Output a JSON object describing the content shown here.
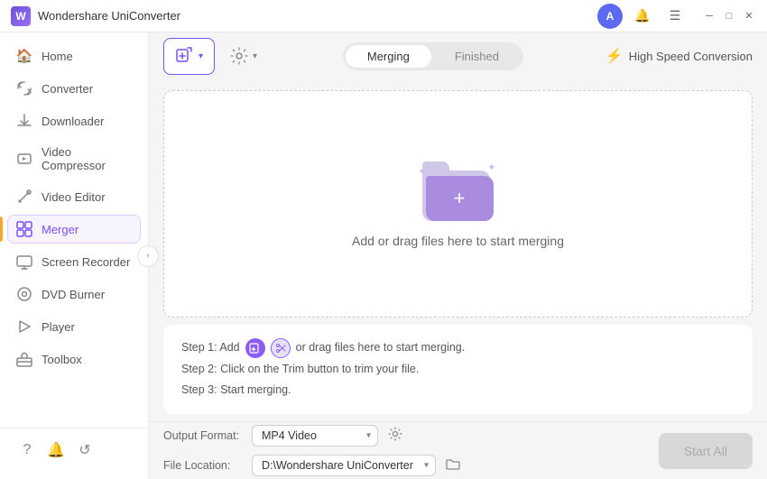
{
  "app": {
    "name": "Wondershare UniConverter",
    "logo_letter": "W"
  },
  "window_controls": {
    "minimize": "─",
    "restore": "□",
    "close": "✕"
  },
  "sidebar": {
    "items": [
      {
        "id": "home",
        "label": "Home",
        "icon": "🏠"
      },
      {
        "id": "converter",
        "label": "Converter",
        "icon": "🔄"
      },
      {
        "id": "downloader",
        "label": "Downloader",
        "icon": "⬇"
      },
      {
        "id": "video-compressor",
        "label": "Video Compressor",
        "icon": "🎞"
      },
      {
        "id": "video-editor",
        "label": "Video Editor",
        "icon": "✂"
      },
      {
        "id": "merger",
        "label": "Merger",
        "icon": "▦",
        "active": true
      },
      {
        "id": "screen-recorder",
        "label": "Screen Recorder",
        "icon": "🖥"
      },
      {
        "id": "dvd-burner",
        "label": "DVD Burner",
        "icon": "💿"
      },
      {
        "id": "player",
        "label": "Player",
        "icon": "▶"
      },
      {
        "id": "toolbox",
        "label": "Toolbox",
        "icon": "🧰"
      }
    ],
    "bottom_icons": [
      "?",
      "🔔",
      "↺"
    ]
  },
  "toolbar": {
    "add_button_label": "",
    "settings_icon": "⚙",
    "tabs": [
      {
        "id": "merging",
        "label": "Merging",
        "active": true
      },
      {
        "id": "finished",
        "label": "Finished",
        "active": false
      }
    ],
    "speed_label": "High Speed Conversion"
  },
  "drop_zone": {
    "text": "Add or drag files here to start merging"
  },
  "instructions": {
    "step1": "Step 1: Add",
    "step1_suffix": "or drag files here to start merging.",
    "step2": "Step 2: Click on the Trim button to trim your file.",
    "step3": "Step 3: Start merging."
  },
  "footer": {
    "output_format_label": "Output Format:",
    "output_format_value": "MP4 Video",
    "file_location_label": "File Location:",
    "file_location_value": "D:\\Wondershare UniConverter",
    "start_all_label": "Start All"
  }
}
